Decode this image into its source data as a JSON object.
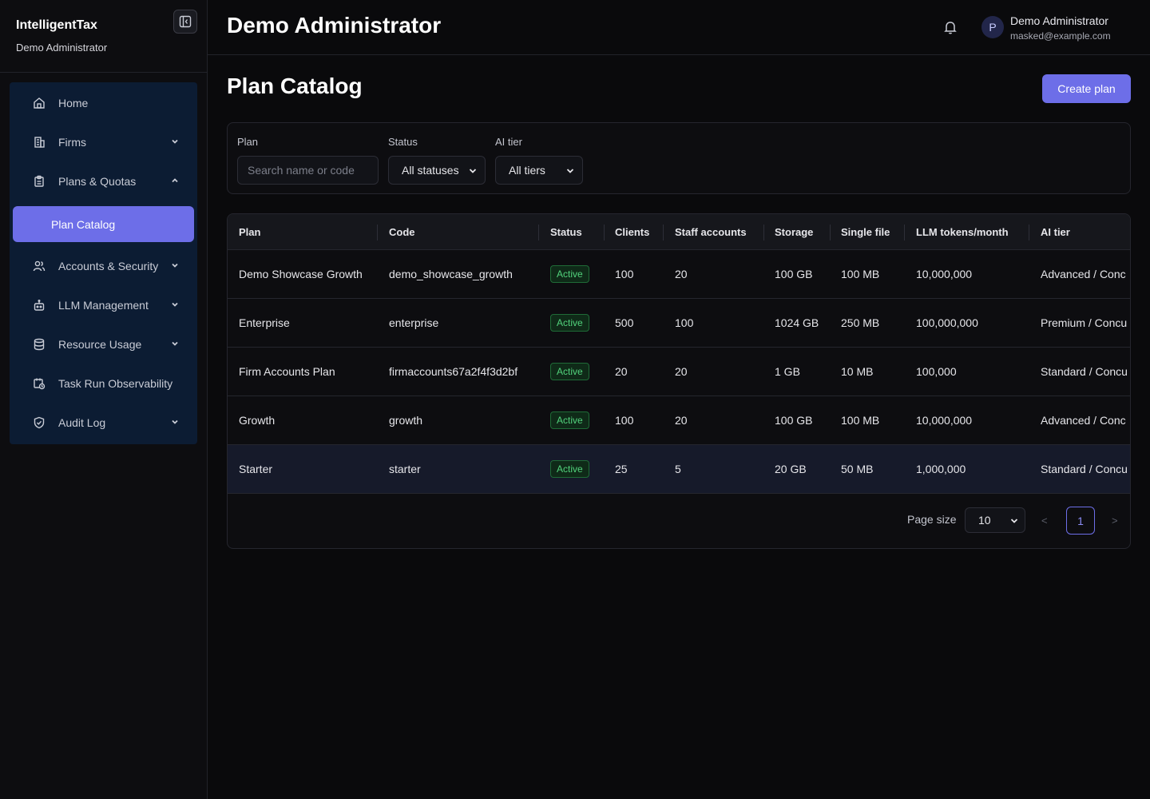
{
  "sidebar": {
    "brand": "IntelligentTax",
    "brand_sub": "Demo Administrator",
    "items": [
      {
        "label": "Home",
        "icon": "home-icon"
      },
      {
        "label": "Firms",
        "icon": "building-icon"
      },
      {
        "label": "Plans & Quotas",
        "icon": "clipboard-icon"
      },
      {
        "label": "Plan Catalog"
      },
      {
        "label": "Accounts & Security",
        "icon": "users-icon"
      },
      {
        "label": "LLM Management",
        "icon": "robot-icon"
      },
      {
        "label": "Resource Usage",
        "icon": "database-icon"
      },
      {
        "label": "Task Run Observability",
        "icon": "calendar-clock-icon"
      },
      {
        "label": "Audit Log",
        "icon": "shield-check-icon"
      }
    ]
  },
  "header": {
    "title": "Demo Administrator",
    "user": {
      "initial": "P",
      "name": "Demo Administrator",
      "email": "masked@example.com"
    }
  },
  "page": {
    "title": "Plan Catalog",
    "create_label": "Create plan"
  },
  "filters": {
    "plan_label": "Plan",
    "plan_placeholder": "Search name or code",
    "status_label": "Status",
    "status_value": "All statuses",
    "tier_label": "AI tier",
    "tier_value": "All tiers"
  },
  "table": {
    "columns": [
      "Plan",
      "Code",
      "Status",
      "Clients",
      "Staff accounts",
      "Storage",
      "Single file",
      "LLM tokens/month",
      "AI tier"
    ],
    "rows": [
      {
        "plan": "Demo Showcase Growth",
        "code": "demo_showcase_growth",
        "status": "Active",
        "clients": "100",
        "staff": "20",
        "storage": "100 GB",
        "single_file": "100 MB",
        "tokens": "10,000,000",
        "tier": "Advanced / Conc"
      },
      {
        "plan": "Enterprise",
        "code": "enterprise",
        "status": "Active",
        "clients": "500",
        "staff": "100",
        "storage": "1024 GB",
        "single_file": "250 MB",
        "tokens": "100,000,000",
        "tier": "Premium / Concu"
      },
      {
        "plan": "Firm Accounts Plan",
        "code": "firmaccounts67a2f4f3d2bf",
        "status": "Active",
        "clients": "20",
        "staff": "20",
        "storage": "1 GB",
        "single_file": "10 MB",
        "tokens": "100,000",
        "tier": "Standard / Concu"
      },
      {
        "plan": "Growth",
        "code": "growth",
        "status": "Active",
        "clients": "100",
        "staff": "20",
        "storage": "100 GB",
        "single_file": "100 MB",
        "tokens": "10,000,000",
        "tier": "Advanced / Conc"
      },
      {
        "plan": "Starter",
        "code": "starter",
        "status": "Active",
        "clients": "25",
        "staff": "5",
        "storage": "20 GB",
        "single_file": "50 MB",
        "tokens": "1,000,000",
        "tier": "Standard / Concu"
      }
    ]
  },
  "pagination": {
    "page_size_label": "Page size",
    "page_size": "10",
    "prev": "<",
    "next": ">",
    "current": "1"
  },
  "colors": {
    "accent": "#6d6ee8",
    "active_badge": "#52d27c",
    "nav_bg": "#0c1c33"
  }
}
